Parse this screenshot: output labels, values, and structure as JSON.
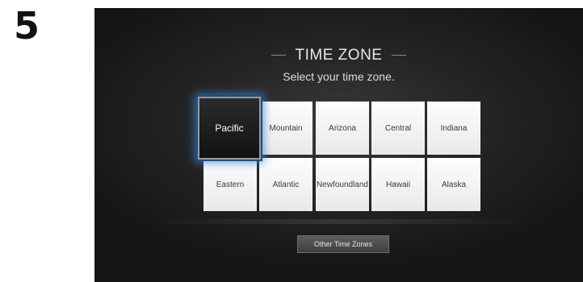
{
  "step": {
    "number": "5"
  },
  "screen": {
    "title": "TIME ZONE",
    "subtitle": "Select your time zone.",
    "selected_zone": "Pacific",
    "zones_row1": [
      "Pacific",
      "Mountain",
      "Arizona",
      "Central",
      "Indiana"
    ],
    "zones_row2": [
      "Eastern",
      "Atlantic",
      "Newfoundland",
      "Hawaii",
      "Alaska"
    ],
    "other_button_label": "Other Time Zones"
  }
}
